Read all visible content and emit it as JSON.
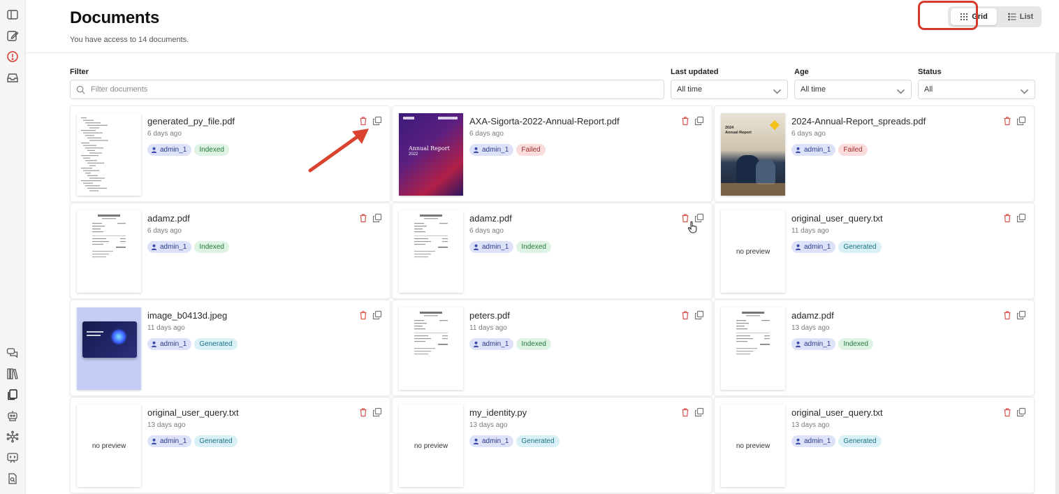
{
  "header": {
    "title": "Documents",
    "subtitle": "You have access to 14 documents.",
    "view_toggle": {
      "grid_label": "Grid",
      "list_label": "List",
      "active": "Grid"
    }
  },
  "filters": {
    "filter_label": "Filter",
    "filter_placeholder": "Filter documents",
    "last_updated_label": "Last updated",
    "last_updated_value": "All time",
    "age_label": "Age",
    "age_value": "All time",
    "status_label": "Status",
    "status_value": "All"
  },
  "sidebar": {
    "top_icons": [
      "sidebar-toggle-icon",
      "edit-icon",
      "alert-icon",
      "inbox-icon"
    ],
    "bottom_icons": [
      "chat-icon",
      "library-icon",
      "documents-icon",
      "robot-icon",
      "network-icon",
      "code-icon",
      "search-file-icon"
    ]
  },
  "no_preview_label": "no preview",
  "documents": [
    {
      "name": "generated_py_file.pdf",
      "age": "6 days ago",
      "owner": "admin_1",
      "status": "Indexed",
      "preview": "code"
    },
    {
      "name": "AXA-Sigorta-2022-Annual-Report.pdf",
      "age": "6 days ago",
      "owner": "admin_1",
      "status": "Failed",
      "preview": "axa",
      "preview_text": [
        "Annual Report",
        "2022"
      ]
    },
    {
      "name": "2024-Annual-Report_spreads.pdf",
      "age": "6 days ago",
      "owner": "admin_1",
      "status": "Failed",
      "preview": "photo",
      "preview_text": [
        "2024",
        "Annual Report"
      ]
    },
    {
      "name": "adamz.pdf",
      "age": "6 days ago",
      "owner": "admin_1",
      "status": "Indexed",
      "preview": "doc"
    },
    {
      "name": "adamz.pdf",
      "age": "6 days ago",
      "owner": "admin_1",
      "status": "Indexed",
      "preview": "doc"
    },
    {
      "name": "original_user_query.txt",
      "age": "11 days ago",
      "owner": "admin_1",
      "status": "Generated",
      "preview": "none"
    },
    {
      "name": "image_b0413d.jpeg",
      "age": "11 days ago",
      "owner": "admin_1",
      "status": "Generated",
      "preview": "image"
    },
    {
      "name": "peters.pdf",
      "age": "11 days ago",
      "owner": "admin_1",
      "status": "Indexed",
      "preview": "doc"
    },
    {
      "name": "adamz.pdf",
      "age": "13 days ago",
      "owner": "admin_1",
      "status": "Indexed",
      "preview": "doc"
    },
    {
      "name": "original_user_query.txt",
      "age": "13 days ago",
      "owner": "admin_1",
      "status": "Generated",
      "preview": "none"
    },
    {
      "name": "my_identity.py",
      "age": "13 days ago",
      "owner": "admin_1",
      "status": "Generated",
      "preview": "none"
    },
    {
      "name": "original_user_query.txt",
      "age": "13 days ago",
      "owner": "admin_1",
      "status": "Generated",
      "preview": "none"
    }
  ],
  "colors": {
    "accent_red": "#d33a2c",
    "user_tag": "#dde2f8",
    "indexed": "#dff3e4",
    "failed": "#fadcdc",
    "generated": "#d9f1f6"
  }
}
